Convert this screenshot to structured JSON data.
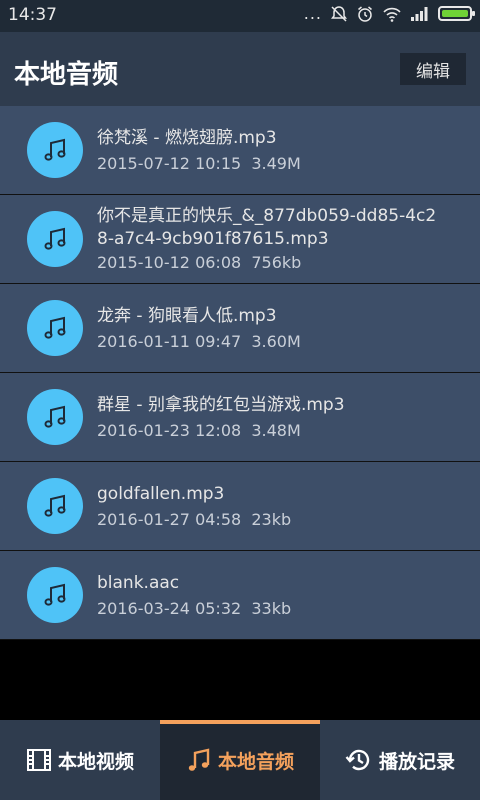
{
  "statusbar": {
    "time": "14:37",
    "dots": "..."
  },
  "header": {
    "title": "本地音频",
    "edit_label": "编辑"
  },
  "files": [
    {
      "name": "徐梵溪 - 燃烧翅膀.mp3",
      "date": "2015-07-12 10:15",
      "size": "3.49M"
    },
    {
      "name": "你不是真正的快乐_&_877db059-dd85-4c28-a7c4-9cb901f87615.mp3",
      "date": "2015-10-12 06:08",
      "size": "756kb"
    },
    {
      "name": "龙奔 - 狗眼看人低.mp3",
      "date": "2016-01-11 09:47",
      "size": "3.60M"
    },
    {
      "name": "群星 - 别拿我的红包当游戏.mp3",
      "date": "2016-01-23 12:08",
      "size": "3.48M"
    },
    {
      "name": "goldfallen.mp3",
      "date": "2016-01-27 04:58",
      "size": "23kb"
    },
    {
      "name": "blank.aac",
      "date": "2016-03-24 05:32",
      "size": "33kb"
    }
  ],
  "tabs": [
    {
      "label": "本地视频",
      "icon": "film-icon",
      "active": false
    },
    {
      "label": "本地音频",
      "icon": "music-note-icon",
      "active": true
    },
    {
      "label": "播放记录",
      "icon": "history-icon",
      "active": false
    }
  ],
  "colors": {
    "accent": "#f4a15c",
    "avatar": "#4fc3f7",
    "row_bg": "#3d4e68",
    "header_bg": "#2f3c4e"
  }
}
